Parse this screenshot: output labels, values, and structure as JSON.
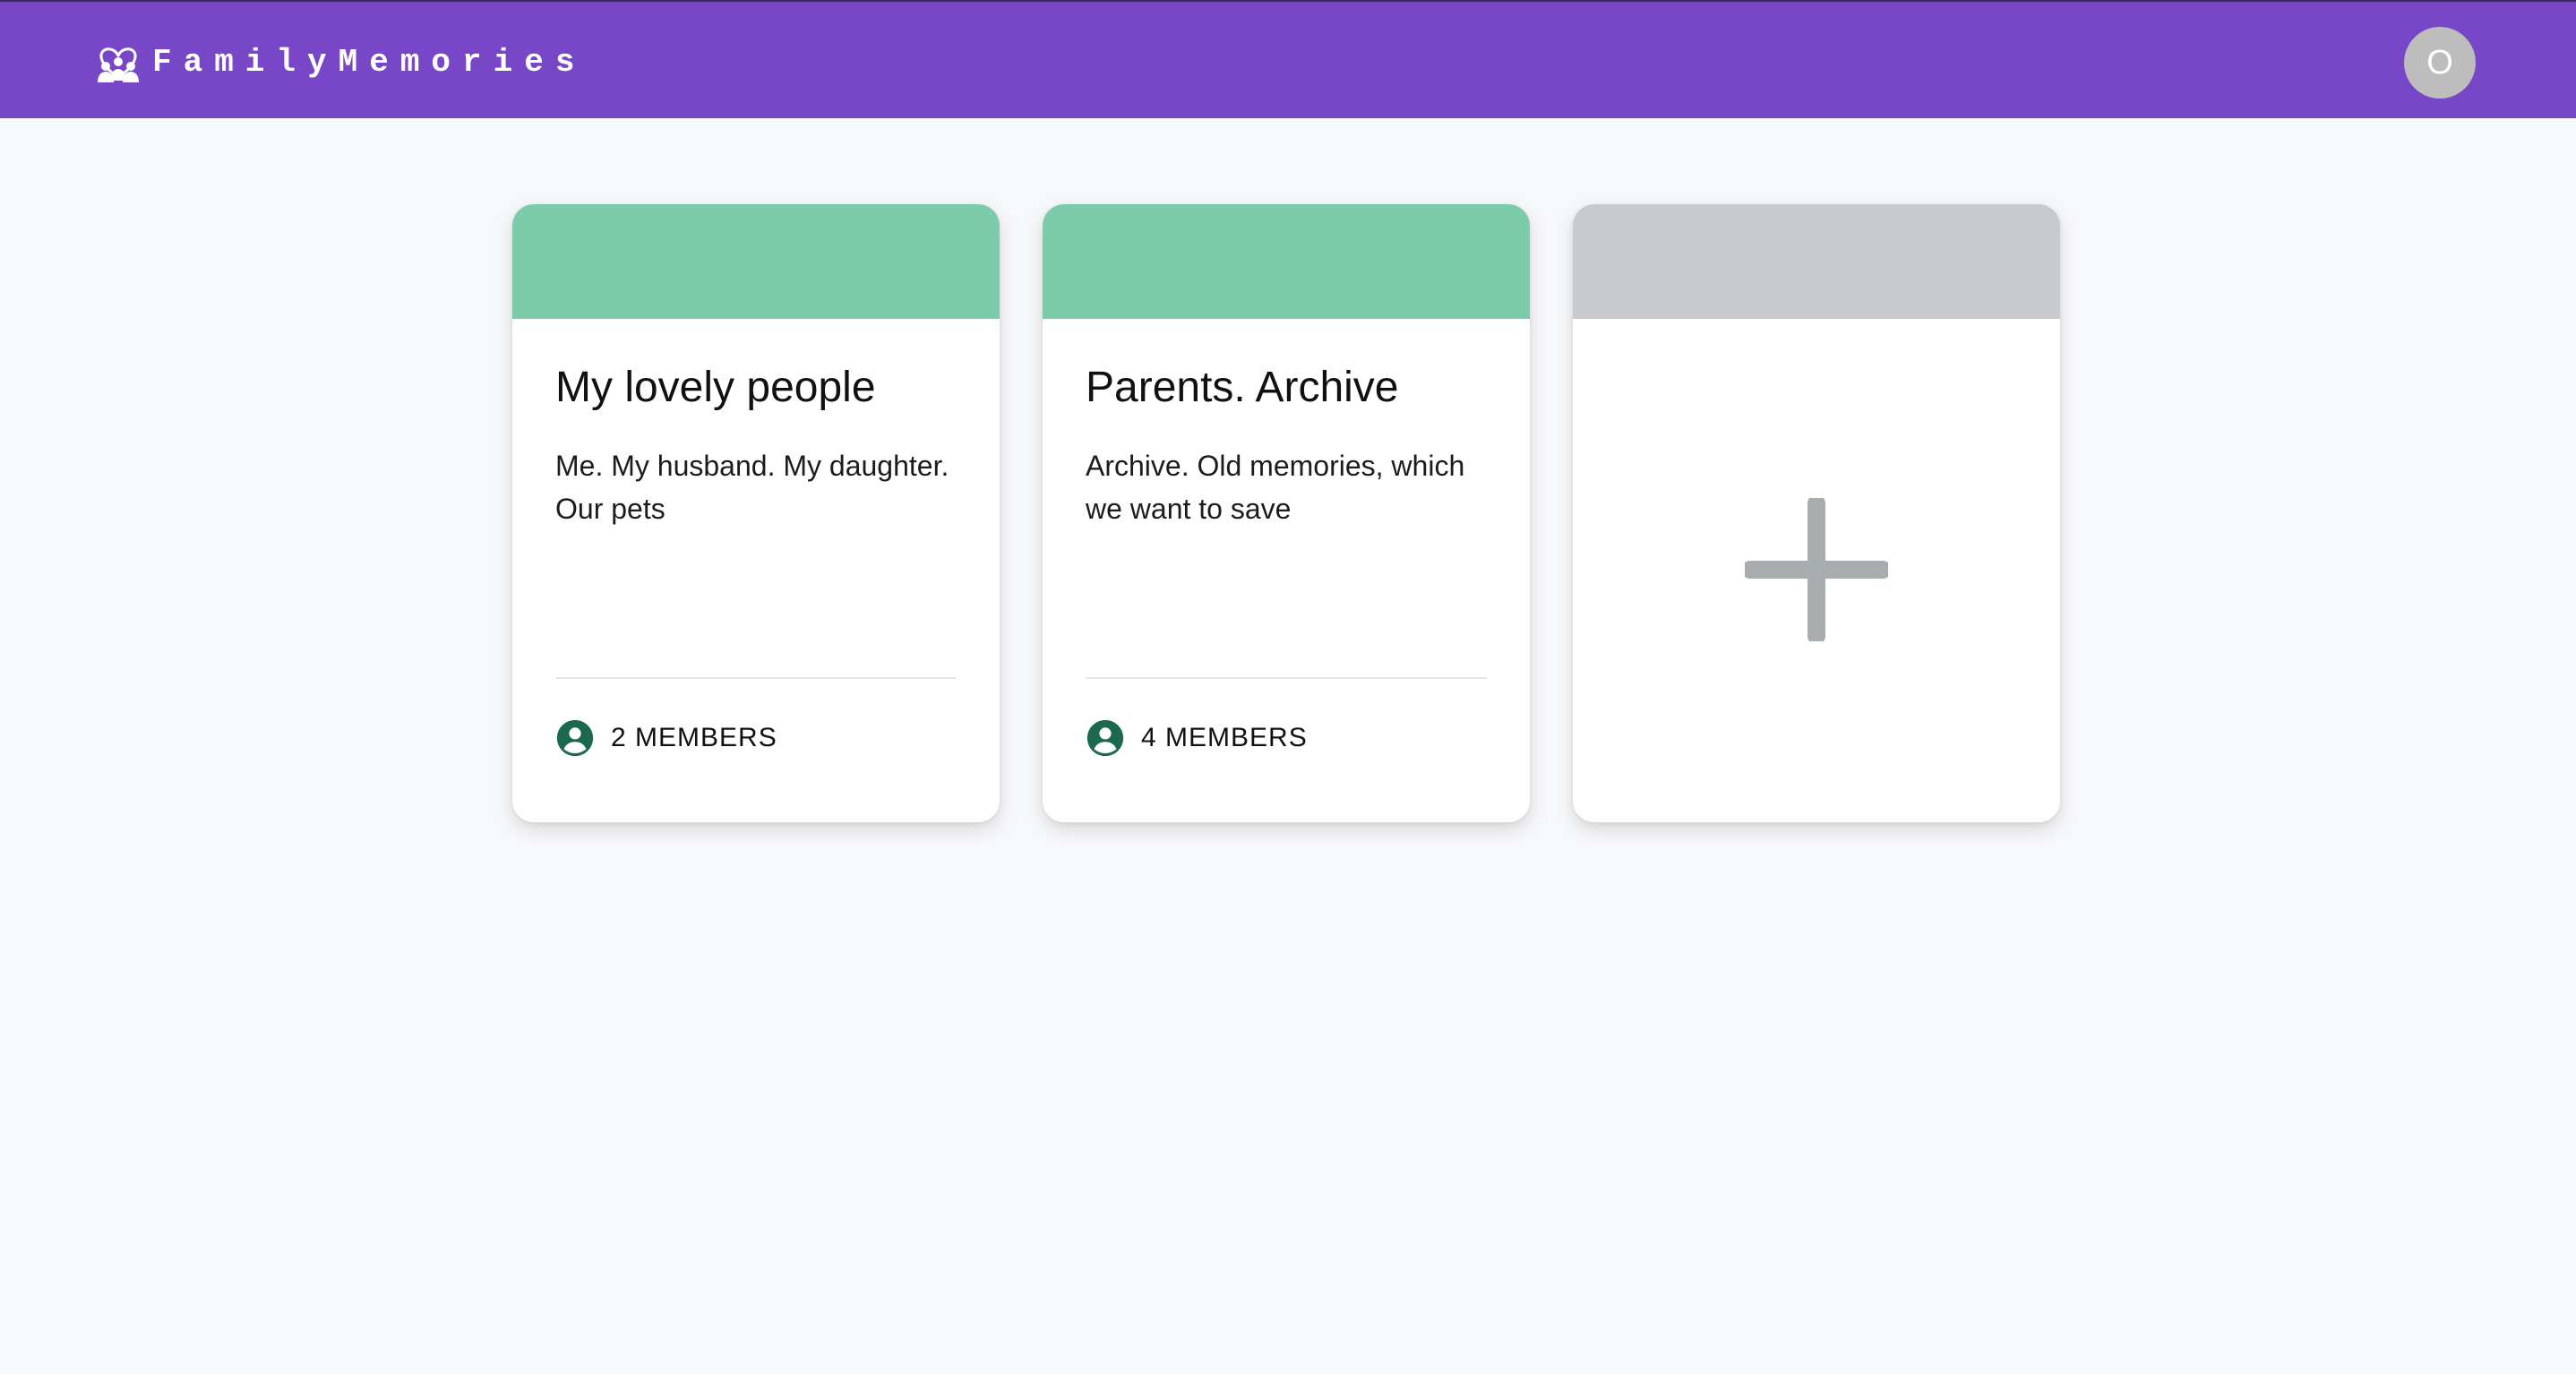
{
  "header": {
    "app_name": "FamilyMemories",
    "logo_icon": "family-group-icon",
    "avatar_initial": "O"
  },
  "colors": {
    "header_bg": "#7847c7",
    "card_banner_green": "#7ccbab",
    "card_banner_gray": "#c8cbce",
    "member_icon": "#1c6a4e",
    "plus_icon": "#a7acaf",
    "page_bg": "#f7f8fa"
  },
  "groups": [
    {
      "title": "My lovely people",
      "description": "Me. My husband. My daughter. Our pets",
      "members_label": "2 MEMBERS",
      "icon": "account-circle-icon"
    },
    {
      "title": "Parents. Archive",
      "description": "Archive. Old memories, which we want to save",
      "members_label": "4 MEMBERS",
      "icon": "account-circle-icon"
    }
  ],
  "add_card": {
    "icon": "plus-icon"
  }
}
